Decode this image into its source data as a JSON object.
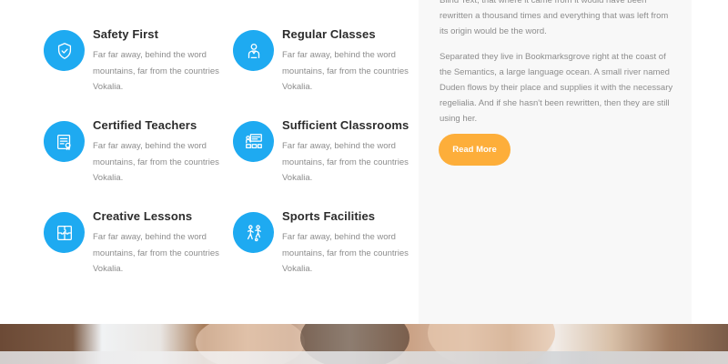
{
  "features": [
    {
      "icon": "shield-check-icon",
      "title": "Safety First",
      "desc": "Far far away, behind the word mountains, far from the countries Vokalia."
    },
    {
      "icon": "teacher-icon",
      "title": "Regular Classes",
      "desc": "Far far away, behind the word mountains, far from the countries Vokalia."
    },
    {
      "icon": "certificate-icon",
      "title": "Certified Teachers",
      "desc": "Far far away, behind the word mountains, far from the countries Vokalia."
    },
    {
      "icon": "classroom-icon",
      "title": "Sufficient Classrooms",
      "desc": "Far far away, behind the word mountains, far from the countries Vokalia."
    },
    {
      "icon": "puzzle-icon",
      "title": "Creative Lessons",
      "desc": "Far far away, behind the word mountains, far from the countries Vokalia."
    },
    {
      "icon": "sports-icon",
      "title": "Sports Facilities",
      "desc": "Far far away, behind the word mountains, far from the countries Vokalia."
    }
  ],
  "aside": {
    "paragraph_1": "Blind Text, that where it came from it would have been rewritten a thousand times and everything that was left from its origin would be the word.",
    "paragraph_2": "Separated they live in Bookmarksgrove right at the coast of the Semantics, a large language ocean. A small river named Duden flows by their place and supplies it with the necessary regelialia. And if she hasn't been rewritten, then they are still using her.",
    "button_label": "Read More"
  },
  "colors": {
    "icon_circle": "#1eaaf1",
    "button": "#fdae3a",
    "title_text": "#2c2c2c",
    "body_text": "#8d8d8d",
    "aside_bg": "#f8f8f8"
  }
}
